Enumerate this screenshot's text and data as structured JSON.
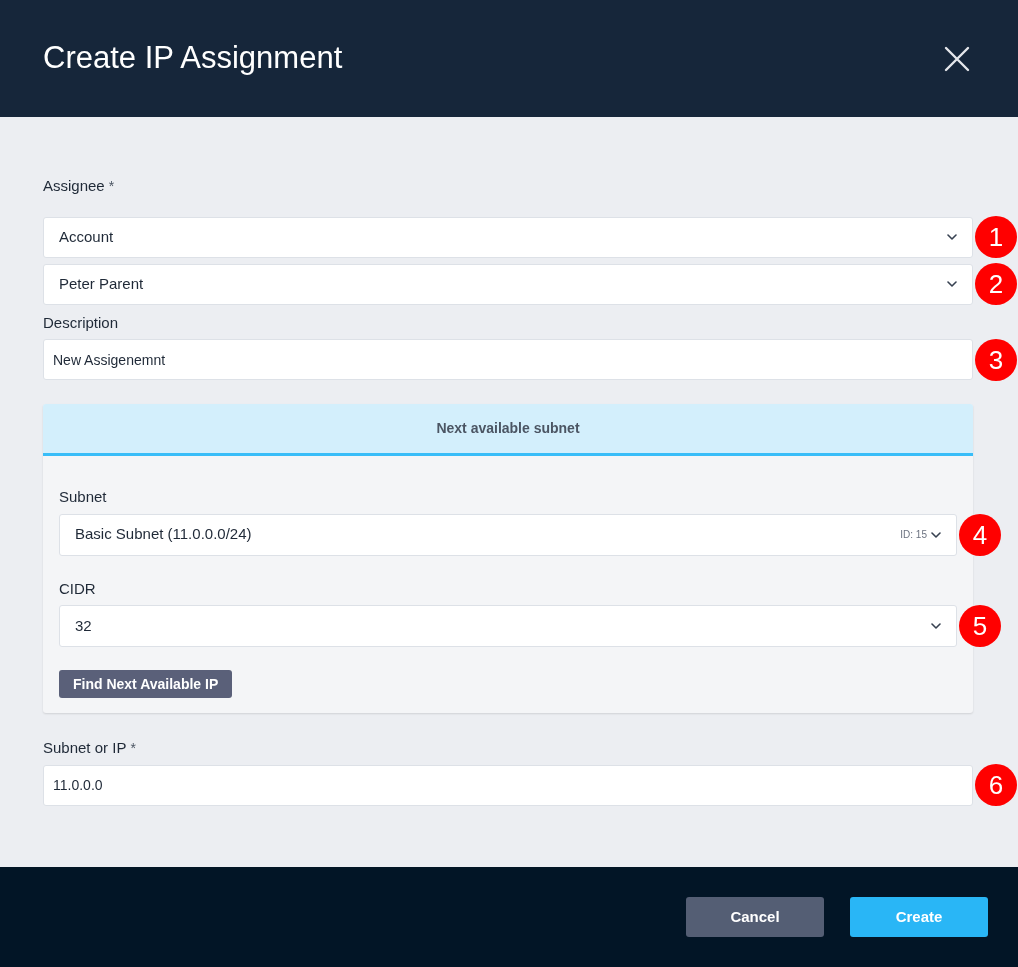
{
  "dialog": {
    "title": "Create IP Assignment"
  },
  "assignee": {
    "label": "Assignee",
    "required_mark": "*",
    "fields": [
      {
        "kind": "select",
        "value": "Account",
        "marker": "1"
      },
      {
        "kind": "select",
        "value": "Peter Parent",
        "marker": "2"
      }
    ]
  },
  "description": {
    "label": "Description",
    "field": {
      "kind": "text",
      "value": "New Assigenemnt",
      "marker": "3"
    }
  },
  "panel": {
    "title": "Next available subnet",
    "fields": [
      {
        "label": "Subnet",
        "kind": "select",
        "value": "Basic Subnet (11.0.0.0/24)",
        "meta": "ID: 15",
        "marker": "4"
      },
      {
        "label": "CIDR",
        "kind": "select",
        "value": "32",
        "marker": "5"
      }
    ],
    "button": "Find Next Available IP"
  },
  "subnet_or_ip": {
    "label": "Subnet or IP",
    "required_mark": "*",
    "field": {
      "kind": "text",
      "value": "11.0.0.0",
      "marker": "6"
    }
  },
  "footer": {
    "buttons": [
      {
        "label": "Cancel",
        "kind": "secondary"
      },
      {
        "label": "Create",
        "kind": "primary"
      }
    ]
  }
}
